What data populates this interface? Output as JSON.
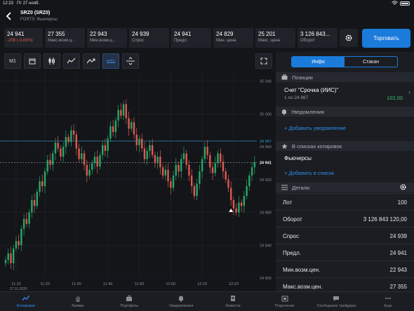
{
  "status_bar": {
    "time": "12:23",
    "date": "Пт 27 нояб."
  },
  "header": {
    "title": "SRZ0 (SRZ0)",
    "subtitle": "FORTS: Фьючерсы"
  },
  "stats": [
    {
      "value": "24 941",
      "label": "-208 (-0,83%)",
      "negative": true
    },
    {
      "value": "27 355",
      "label": "Макс.возм.ц..."
    },
    {
      "value": "22 943",
      "label": "Мин.возм.ц..."
    },
    {
      "value": "24 939",
      "label": "Спрос"
    },
    {
      "value": "24 941",
      "label": "Предл."
    },
    {
      "value": "24 829",
      "label": "Мин. цена"
    },
    {
      "value": "25 201",
      "label": "Макс. цена"
    },
    {
      "value": "3 126 843...",
      "label": "Оборот"
    }
  ],
  "trade_button": "Торговать",
  "toolbar": {
    "interval": "M1"
  },
  "chart_data": {
    "type": "candlestick",
    "date_label": "27.11.2020",
    "x_ticks": [
      "11:10",
      "11:20",
      "11:30",
      "11:40",
      "11:50",
      "12:00",
      "12:10",
      "12:20"
    ],
    "y_ticks": [
      25040,
      25000,
      24960,
      24920,
      24880,
      24840,
      24800
    ],
    "y_range": [
      24800,
      25050
    ],
    "bid_line": 24967,
    "last_price": 24941,
    "colors": {
      "up": "#27a86a",
      "down": "#e05a4f",
      "bid": "#3a9fd6"
    },
    "closes": [
      24822,
      24830,
      24818,
      24836,
      24845,
      24840,
      24860,
      24872,
      24866,
      24880,
      24895,
      24888,
      24905,
      24918,
      24912,
      24930,
      24944,
      24938,
      24952,
      24965,
      24958,
      24948,
      24960,
      24972,
      24966,
      24980,
      24975,
      24958,
      24945,
      24952,
      24938,
      24925,
      24932,
      24940,
      24948,
      24936,
      24950,
      24962,
      24955,
      24970,
      24985,
      24978,
      24992,
      25005,
      24998,
      25012,
      24995,
      24982,
      24990,
      24975,
      24962,
      24970,
      24958,
      24945,
      24955,
      24962,
      24950,
      24940,
      24948,
      24935,
      24925,
      24932,
      24918,
      24910,
      24925,
      24938,
      24930,
      24945,
      24952,
      24938,
      24925,
      24912,
      24900,
      24915,
      24930,
      24945,
      24960,
      24950,
      24935,
      24928,
      24940,
      24952,
      24942,
      24930,
      24920,
      24910,
      24895,
      24885,
      24880,
      24892,
      24888,
      24900,
      24912,
      24925,
      24935,
      24941
    ]
  },
  "panel": {
    "tab_info": "Инфо",
    "tab_book": "Стакан",
    "positions_title": "Позиции",
    "account_name": "Счет \"Срочка (ИИС)\"",
    "account_sub": "1 по 24 987",
    "account_value": "102,00",
    "alerts_title": "Уведомления",
    "add_alert": "Добавить уведомление",
    "lists_title": "В списках котировок",
    "list_name": "Фьючерсы",
    "add_list": "Добавить в список",
    "details_title": "Детали",
    "details": [
      {
        "k": "Лот",
        "v": "100"
      },
      {
        "k": "Оборот",
        "v": "3 126 843 120,00"
      },
      {
        "k": "Спрос",
        "v": "24 939"
      },
      {
        "k": "Предл.",
        "v": "24 941"
      },
      {
        "k": "Мин.возм.цен.",
        "v": "22 943"
      },
      {
        "k": "Макс.возм.цен.",
        "v": "27 355"
      }
    ]
  },
  "tabbar": [
    {
      "label": "Котировки",
      "icon": "chart-line-icon",
      "active": true
    },
    {
      "label": "Заявки",
      "icon": "hand-icon"
    },
    {
      "label": "Портфель",
      "icon": "briefcase-icon"
    },
    {
      "label": "Уведомления",
      "icon": "bell-icon"
    },
    {
      "label": "Новости",
      "icon": "document-icon"
    },
    {
      "label": "Поручения",
      "icon": "inbox-icon"
    },
    {
      "label": "Сообщения трейдера",
      "icon": "chat-icon"
    },
    {
      "label": "Еще",
      "icon": "more-icon"
    }
  ]
}
